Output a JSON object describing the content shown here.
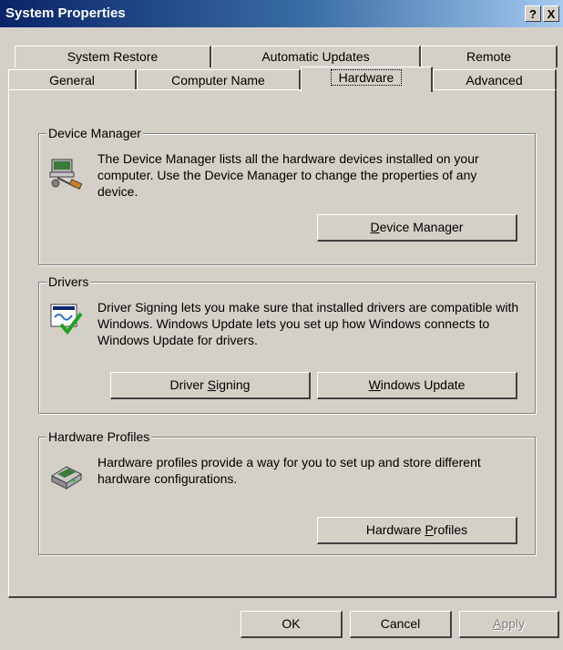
{
  "window": {
    "title": "System Properties",
    "help_label": "?",
    "close_label": "X"
  },
  "tabs_back": [
    {
      "label": "System Restore"
    },
    {
      "label": "Automatic Updates"
    },
    {
      "label": "Remote"
    }
  ],
  "tabs_front": [
    {
      "label": "General"
    },
    {
      "label": "Computer Name"
    },
    {
      "label": "Hardware"
    },
    {
      "label": "Advanced"
    }
  ],
  "device_manager": {
    "group_label": "Device Manager",
    "description": "The Device Manager lists all the hardware devices installed on your computer. Use the Device Manager to change the properties of any device.",
    "button": {
      "mnemonic": "D",
      "rest": "evice Manager"
    },
    "icon": "device-manager-icon"
  },
  "drivers": {
    "group_label": "Drivers",
    "description": "Driver Signing lets you make sure that installed drivers are compatible with Windows. Windows Update lets you set up how Windows connects to Windows Update for drivers.",
    "signing_button": {
      "pre": "Driver ",
      "mnemonic": "S",
      "rest": "igning"
    },
    "update_button": {
      "mnemonic": "W",
      "rest": "indows Update"
    },
    "icon": "driver-signing-icon"
  },
  "hardware_profiles": {
    "group_label": "Hardware Profiles",
    "description": "Hardware profiles provide a way for you to set up and store different hardware configurations.",
    "button": {
      "pre": "Hardware ",
      "mnemonic": "P",
      "rest": "rofiles"
    },
    "icon": "hardware-profiles-icon"
  },
  "footer": {
    "ok_label": "OK",
    "cancel_label": "Cancel",
    "apply_mnemonic": "A",
    "apply_rest": "pply"
  },
  "colors": {
    "face": "#d4d0c8",
    "title_start": "#0a246a",
    "title_end": "#a6caf0"
  }
}
